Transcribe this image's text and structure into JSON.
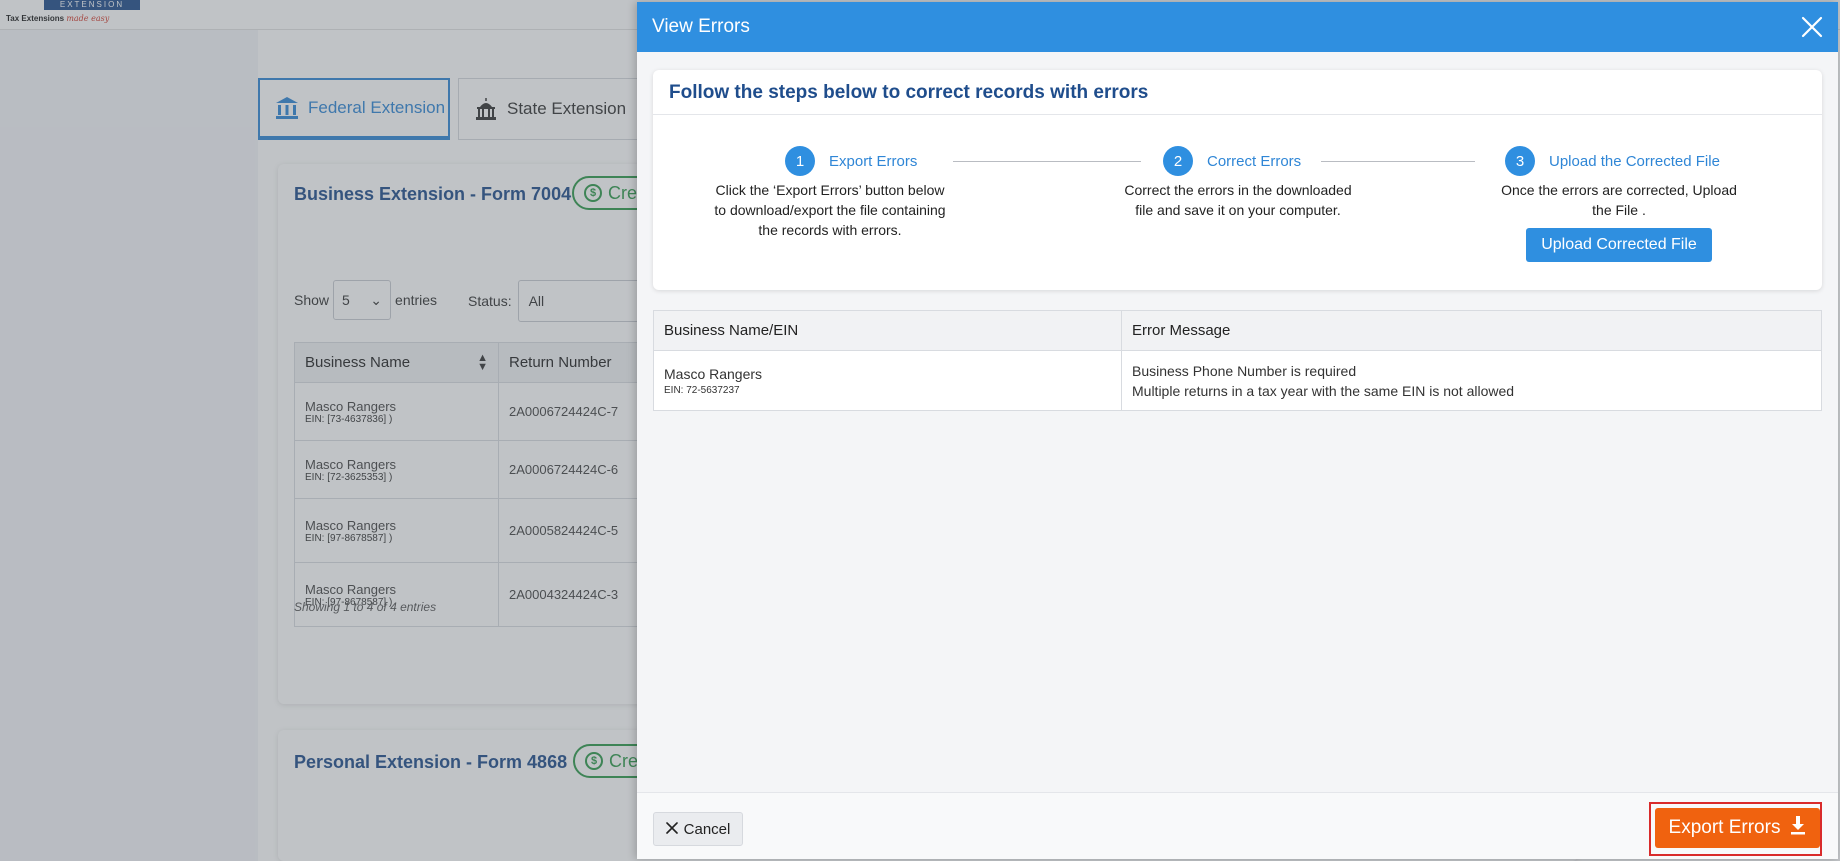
{
  "logo": {
    "mark": "EXTENSION",
    "text": "Tax Extensions",
    "tagline": "made easy"
  },
  "tabs": [
    {
      "label": "Federal Extension",
      "icon": "bank-icon",
      "active": true
    },
    {
      "label": "State Extension",
      "icon": "capitol-icon",
      "active": false
    }
  ],
  "business_card": {
    "title": "Business Extension - Form 7004",
    "credit_label": "Cred",
    "show_label": "Show",
    "entries_count": "5",
    "entries_label": "entries",
    "status_label": "Status:",
    "status_value": "All",
    "columns": [
      "Business Name",
      "Return Number"
    ],
    "rows": [
      {
        "name": "Masco Rangers",
        "ein": "EIN: [73-4637836] )",
        "return_number": "2A0006724424C-7"
      },
      {
        "name": "Masco Rangers",
        "ein": "EIN: [72-3625353] )",
        "return_number": "2A0006724424C-6"
      },
      {
        "name": "Masco Rangers",
        "ein": "EIN: [97-8678587] )",
        "return_number": "2A0005824424C-5"
      },
      {
        "name": "Masco Rangers",
        "ein": "EIN: [97-8678587] )",
        "return_number": "2A0004324424C-3"
      }
    ],
    "showing_text": "Showing 1 to 4 of 4 entries"
  },
  "personal_card": {
    "title": "Personal Extension - Form 4868",
    "credit_label": "Cred"
  },
  "modal": {
    "title": "View Errors",
    "steps_title": "Follow the steps below to correct records with errors",
    "steps": [
      {
        "number": "1",
        "label": "Export Errors",
        "desc_lines": [
          "Click the ‘Export Errors’ button below",
          "to download/export the file containing",
          "the records with errors."
        ]
      },
      {
        "number": "2",
        "label": "Correct Errors",
        "desc_lines": [
          "Correct the errors in the downloaded",
          "file and save it on your computer."
        ]
      },
      {
        "number": "3",
        "label": "Upload the Corrected File",
        "desc_lines": [
          "Once the errors are corrected, Upload",
          "the File ."
        ]
      }
    ],
    "upload_button": "Upload Corrected File",
    "table": {
      "columns": [
        "Business Name/EIN",
        "Error Message"
      ],
      "rows": [
        {
          "name": "Masco Rangers",
          "ein": "EIN: 72-5637237",
          "messages": [
            "Business Phone Number is required",
            "Multiple returns in a tax year with the same EIN is not allowed"
          ]
        }
      ]
    },
    "cancel_button": "Cancel",
    "export_button": "Export Errors"
  },
  "colors": {
    "primary": "#2f8fe0",
    "title_blue": "#1f4d8c",
    "export_orange": "#f0620f",
    "highlight_red": "#d92b2b",
    "credit_green": "#2e9a4b"
  }
}
